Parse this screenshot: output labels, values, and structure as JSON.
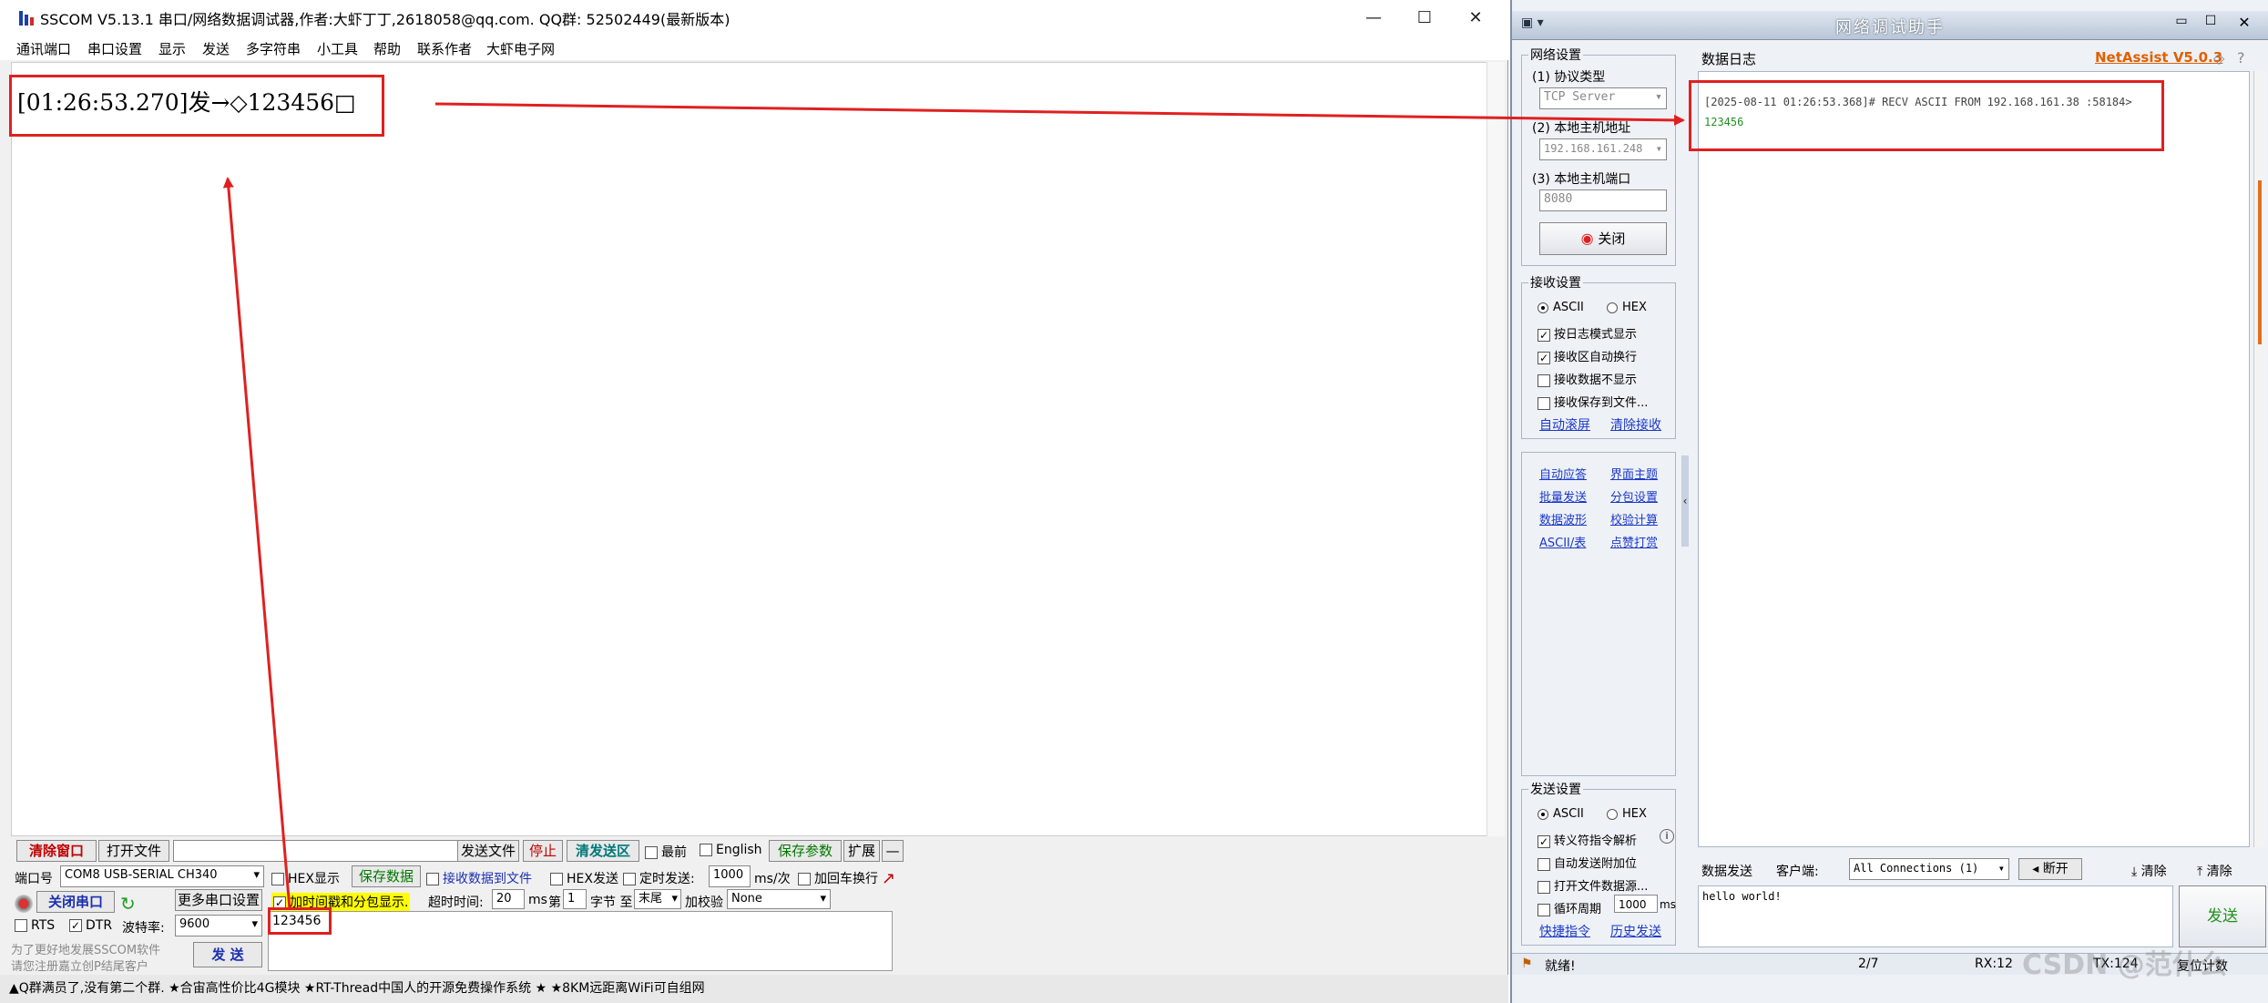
{
  "sscom": {
    "title": "SSCOM V5.13.1 串口/网络数据调试器,作者:大虾丁丁,2618058@qq.com. QQ群: 52502449(最新版本)",
    "menu": [
      "通讯端口",
      "串口设置",
      "显示",
      "发送",
      "多字符串",
      "小工具",
      "帮助",
      "联系作者",
      "大虾电子网"
    ],
    "rx_line": "[01:26:53.270]发→◇123456□",
    "toolbar": {
      "clear_window": "清除窗口",
      "open_file": "打开文件",
      "send_file": "发送文件",
      "stop": "停止",
      "clear_send": "清发送区",
      "topmost": "最前",
      "english": "English",
      "save_params": "保存参数",
      "expand": "扩展",
      "dash": "—"
    },
    "port_label": "端口号",
    "port_value": "COM8 USB-SERIAL CH340",
    "hex_display": "HEX显示",
    "save_data": "保存数据",
    "recv_to_file": "接收数据到文件",
    "hex_send": "HEX发送",
    "timed_send": "定时发送:",
    "interval_value": "1000",
    "interval_unit": "ms/次",
    "add_crlf": "加回车换行",
    "more_ports": "更多串口设置",
    "close_port": "关闭串口",
    "add_timestamp": "加时间戳和分包显示.",
    "timeout_label": "超时时间:",
    "timeout_value": "20",
    "timeout_unit": "ms",
    "byte_label_1": "第",
    "byte_index": "1",
    "byte_label_2": "字节 至",
    "byte_end": "末尾",
    "checksum_label": "加校验",
    "checksum_value": "None",
    "rts": "RTS",
    "dtr": "DTR",
    "baud_label": "波特率:",
    "baud_value": "9600",
    "send_text": "123456",
    "promo_1": "为了更好地发展SSCOM软件",
    "promo_2": "请您注册嘉立创P结尾客户",
    "send_button": "发 送",
    "status": "▲Q群满员了,没有第二个群. ★合宙高性价比4G模块 ★RT-Thread中国人的开源免费操作系统 ★ ★8KM远距离WiFi可自组网"
  },
  "netassist": {
    "title": "网络调试助手",
    "brand": "NetAssist V5.0.3",
    "net_settings": "网络设置",
    "protocol_label": "(1) 协议类型",
    "protocol_value": "TCP Server",
    "host_label": "(2) 本地主机地址",
    "host_value": "192.168.161.248",
    "port_label": "(3) 本地主机端口",
    "port_value": "8080",
    "close_button": "关闭",
    "recv_settings": "接收设置",
    "ascii": "ASCII",
    "hex": "HEX",
    "recv_opts": [
      "按日志模式显示",
      "接收区自动换行",
      "接收数据不显示",
      "接收保存到文件..."
    ],
    "recv_opts_checked": [
      true,
      true,
      false,
      false
    ],
    "auto_scroll": "自动滚屏",
    "clear_recv": "清除接收",
    "tools": [
      "自动应答",
      "界面主题",
      "批量发送",
      "分包设置",
      "数据波形",
      "校验计算",
      "ASCII/表",
      "点赞打赏"
    ],
    "send_settings": "发送设置",
    "send_opts": [
      "转义符指令解析",
      "自动发送附加位",
      "打开文件数据源...",
      "循环周期"
    ],
    "send_opts_checked": [
      true,
      false,
      false,
      false
    ],
    "cycle_value": "1000",
    "cycle_unit": "ms",
    "shortcut": "快捷指令",
    "history": "历史发送",
    "log_tab": "数据日志",
    "log_header": "[2025-08-11 01:26:53.368]# RECV ASCII FROM 192.168.161.38 :58184>",
    "log_data": "123456",
    "send_tab": "数据发送",
    "client_label": "客户端:",
    "client_value": "All Connections (1)",
    "disconnect": "断开",
    "clear_1": "清除",
    "clear_2": "清除",
    "send_input": "hello world!",
    "send_button": "发送",
    "status_ready": "就绪!",
    "status_count": "2/7",
    "status_rx": "RX:12",
    "status_tx": "TX:124",
    "status_reset": "复位计数",
    "watermark": "CSDN @范什么"
  }
}
